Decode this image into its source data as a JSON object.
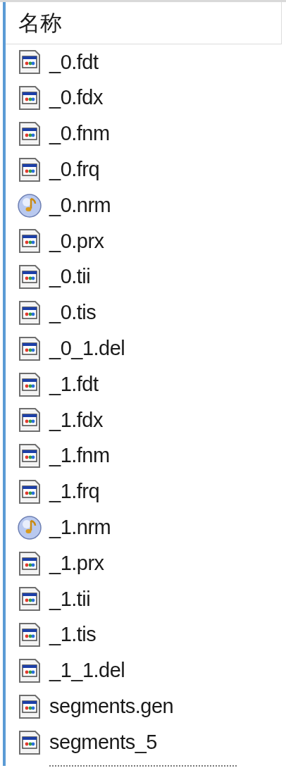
{
  "header": {
    "column_1": "名称"
  },
  "files": [
    {
      "name": "_0.fdt",
      "kind": "app"
    },
    {
      "name": "_0.fdx",
      "kind": "app"
    },
    {
      "name": "_0.fnm",
      "kind": "app"
    },
    {
      "name": "_0.frq",
      "kind": "app"
    },
    {
      "name": "_0.nrm",
      "kind": "audio"
    },
    {
      "name": "_0.prx",
      "kind": "app"
    },
    {
      "name": "_0.tii",
      "kind": "app"
    },
    {
      "name": "_0.tis",
      "kind": "app"
    },
    {
      "name": "_0_1.del",
      "kind": "app"
    },
    {
      "name": "_1.fdt",
      "kind": "app"
    },
    {
      "name": "_1.fdx",
      "kind": "app"
    },
    {
      "name": "_1.fnm",
      "kind": "app"
    },
    {
      "name": "_1.frq",
      "kind": "app"
    },
    {
      "name": "_1.nrm",
      "kind": "audio"
    },
    {
      "name": "_1.prx",
      "kind": "app"
    },
    {
      "name": "_1.tii",
      "kind": "app"
    },
    {
      "name": "_1.tis",
      "kind": "app"
    },
    {
      "name": "_1_1.del",
      "kind": "app"
    },
    {
      "name": "segments.gen",
      "kind": "app"
    },
    {
      "name": "segments_5",
      "kind": "app"
    }
  ]
}
